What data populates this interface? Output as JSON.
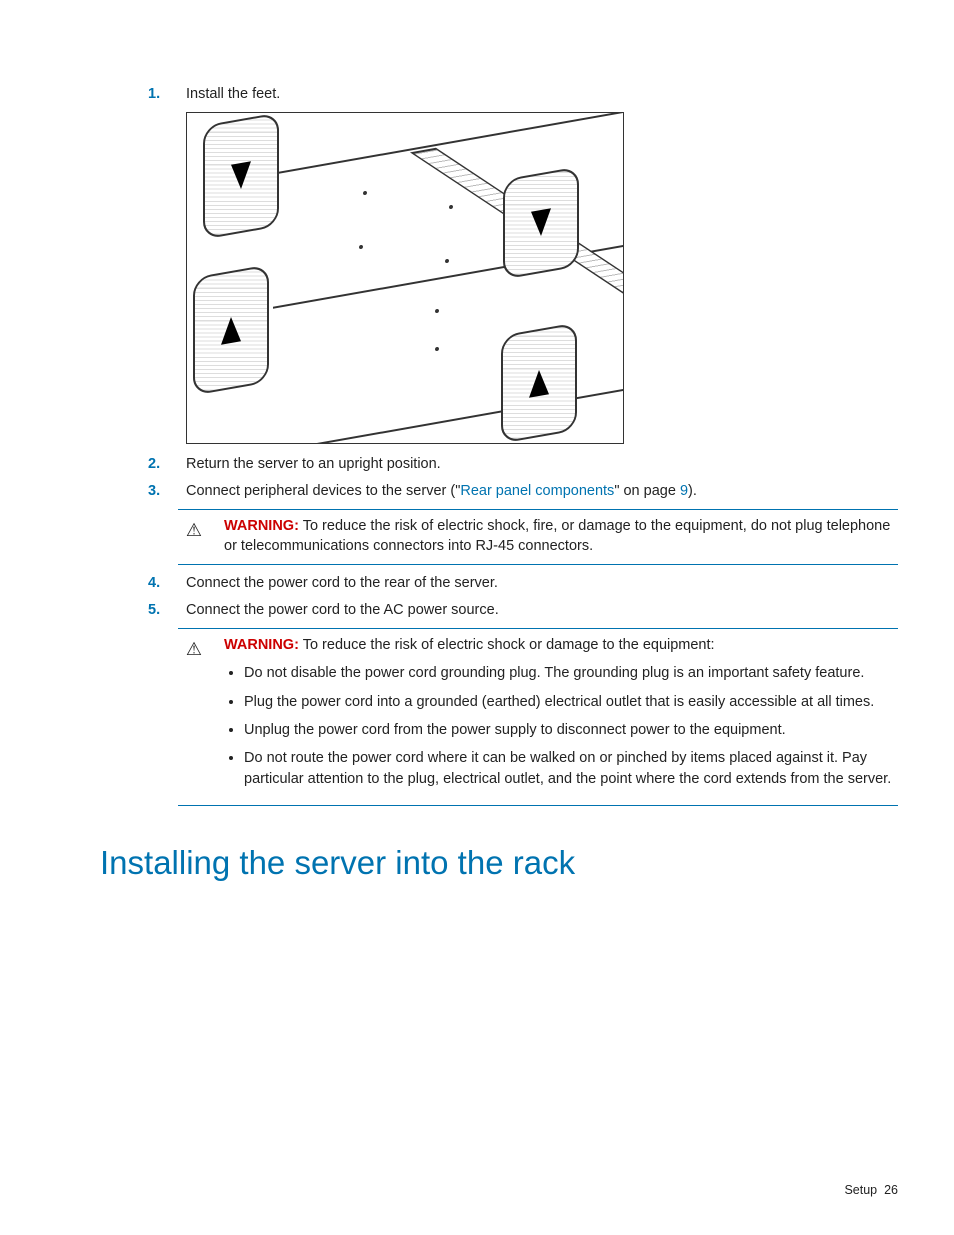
{
  "steps": {
    "s1_num": "1.",
    "s1_text": "Install the feet.",
    "s2_num": "2.",
    "s2_text": "Return the server to an upright position.",
    "s3_num": "3.",
    "s3_text_a": "Connect peripheral devices to the server (\"",
    "s3_link": "Rear panel components",
    "s3_text_b": "\" on page ",
    "s3_page": "9",
    "s3_text_c": ").",
    "s4_num": "4.",
    "s4_text": "Connect the power cord to the rear of the server.",
    "s5_num": "5.",
    "s5_text": "Connect the power cord to the AC power source."
  },
  "warning1": {
    "label": "WARNING:",
    "text": "To reduce the risk of electric shock, fire, or damage to the equipment, do not plug telephone or telecommunications connectors into RJ-45 connectors."
  },
  "warning2": {
    "label": "WARNING:",
    "intro": "To reduce the risk of electric shock or damage to the equipment:",
    "bullets": {
      "b1": "Do not disable the power cord grounding plug. The grounding plug is an important safety feature.",
      "b2": "Plug the power cord into a grounded (earthed) electrical outlet that is easily accessible at all times.",
      "b3": "Unplug the power cord from the power supply to disconnect power to the equipment.",
      "b4": "Do not route the power cord where it can be walked on or pinched by items placed against it. Pay particular attention to the plug, electrical outlet, and the point where the cord extends from the server."
    }
  },
  "heading": "Installing the server into the rack",
  "footer": {
    "section": "Setup",
    "page": "26"
  },
  "icons": {
    "warning_glyph": "⚠"
  }
}
